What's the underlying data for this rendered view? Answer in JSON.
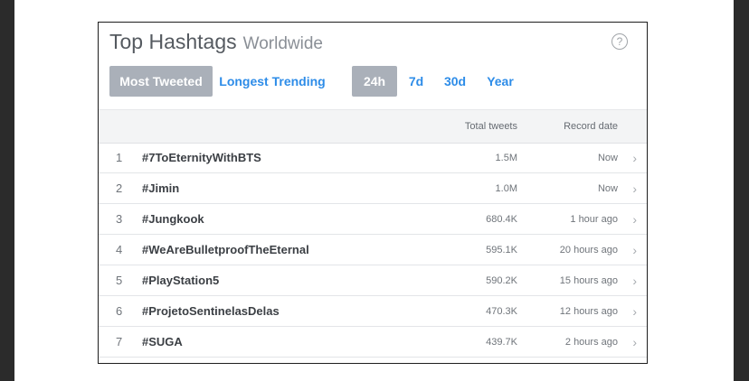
{
  "widget": {
    "title": "Top Hashtags",
    "subtitle": "Worldwide",
    "help_icon": "?"
  },
  "filters": {
    "most_tweeted": "Most Tweeted",
    "longest_trending": "Longest Trending",
    "period_24h": "24h",
    "period_7d": "7d",
    "period_30d": "30d",
    "period_year": "Year",
    "active_tab": "Most Tweeted",
    "active_period": "24h"
  },
  "table": {
    "col_total": "Total tweets",
    "col_date": "Record date",
    "rows": [
      {
        "rank": "1",
        "tag": "#7ToEternityWithBTS",
        "total": "1.5M",
        "date": "Now"
      },
      {
        "rank": "2",
        "tag": "#Jimin",
        "total": "1.0M",
        "date": "Now"
      },
      {
        "rank": "3",
        "tag": "#Jungkook",
        "total": "680.4K",
        "date": "1 hour ago"
      },
      {
        "rank": "4",
        "tag": "#WeAreBulletproofTheEternal",
        "total": "595.1K",
        "date": "20 hours ago"
      },
      {
        "rank": "5",
        "tag": "#PlayStation5",
        "total": "590.2K",
        "date": "15 hours ago"
      },
      {
        "rank": "6",
        "tag": "#ProjetoSentinelasDelas",
        "total": "470.3K",
        "date": "12 hours ago"
      },
      {
        "rank": "7",
        "tag": "#SUGA",
        "total": "439.7K",
        "date": "2 hours ago"
      }
    ]
  },
  "colors": {
    "accent": "#2d8ce8",
    "active_pill": "#aab0b9",
    "frame": "#2b2b2b"
  },
  "icons": {
    "help": "question-circle-icon",
    "row_chevron": "chevron-right-icon"
  }
}
